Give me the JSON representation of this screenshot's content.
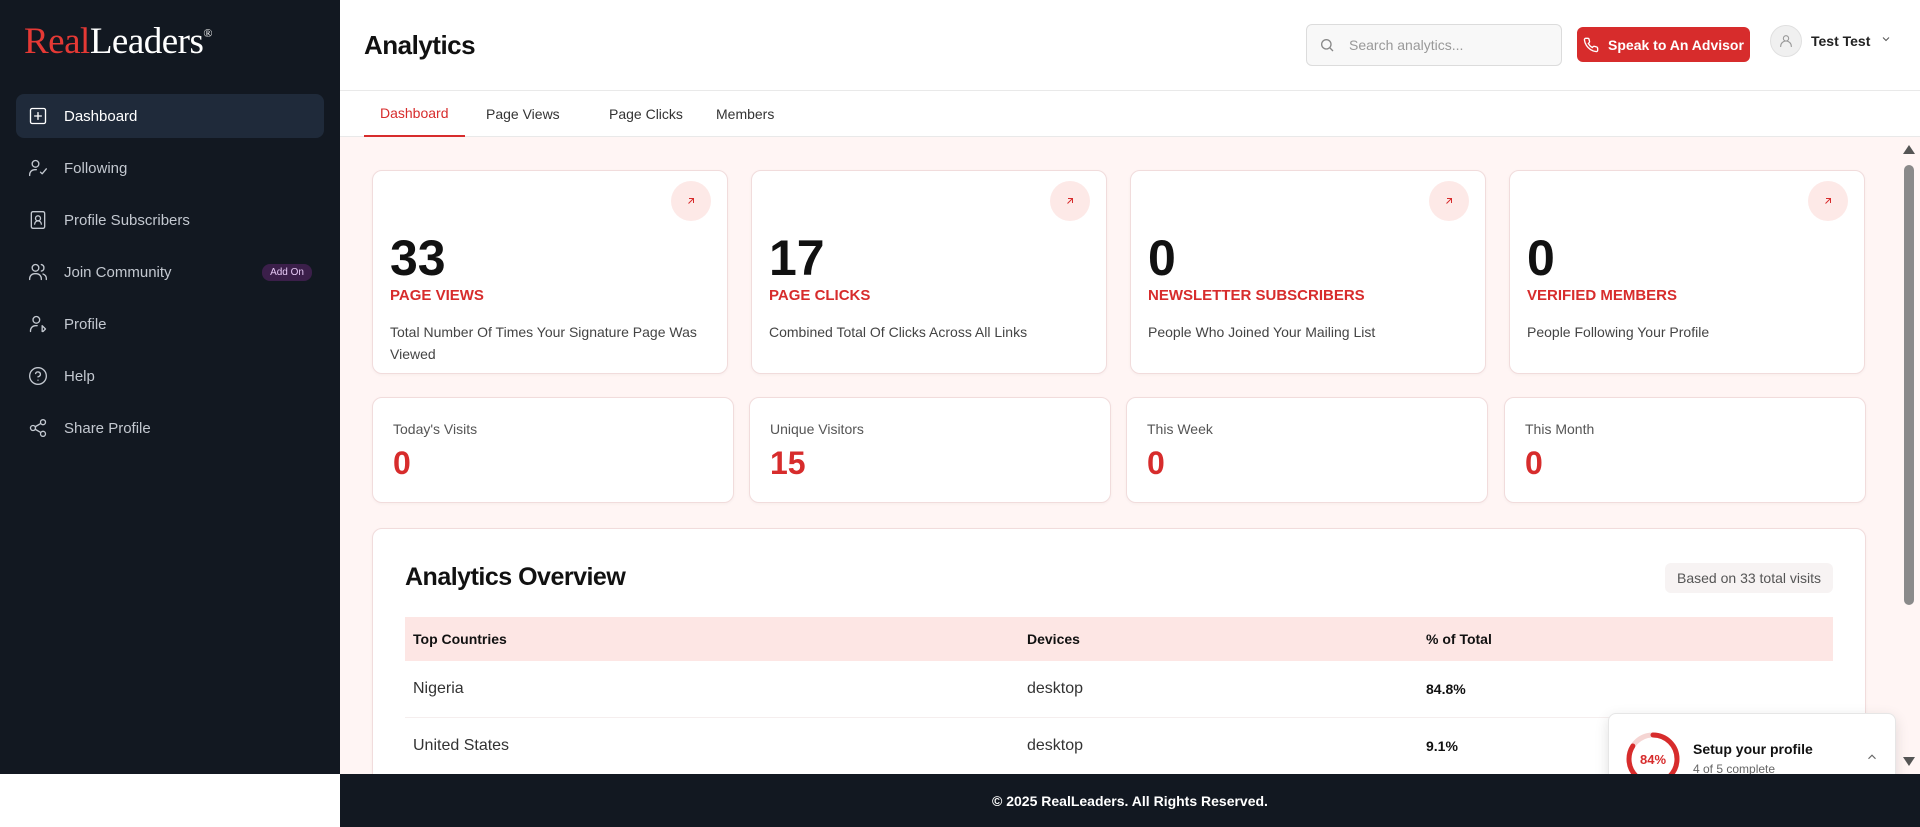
{
  "brand": {
    "logo_red": "Real",
    "logo_white": "Leaders",
    "logo_mark": "®"
  },
  "sidebar": {
    "items": [
      {
        "label": "Dashboard",
        "icon": "plus-square-icon",
        "active": true
      },
      {
        "label": "Following",
        "icon": "user-check-icon"
      },
      {
        "label": "Profile Subscribers",
        "icon": "contact-book-icon"
      },
      {
        "label": "Join Community",
        "icon": "users-icon",
        "badge": "Add On"
      },
      {
        "label": "Profile",
        "icon": "user-edit-icon"
      },
      {
        "label": "Help",
        "icon": "help-circle-icon"
      },
      {
        "label": "Share Profile",
        "icon": "share-icon"
      }
    ]
  },
  "header": {
    "title": "Analytics",
    "search_placeholder": "Search analytics...",
    "advisor_label": "Speak to An Advisor",
    "user_name": "Test Test"
  },
  "tabs": [
    {
      "label": "Dashboard",
      "active": true
    },
    {
      "label": "Page Views"
    },
    {
      "label": "Page Clicks"
    },
    {
      "label": "Members"
    }
  ],
  "stats": [
    {
      "value": "33",
      "label": "PAGE VIEWS",
      "desc": "Total Number Of Times Your Signature Page Was Viewed"
    },
    {
      "value": "17",
      "label": "PAGE CLICKS",
      "desc": "Combined Total Of Clicks Across All Links"
    },
    {
      "value": "0",
      "label": "NEWSLETTER SUBSCRIBERS",
      "desc": "People Who Joined Your Mailing List"
    },
    {
      "value": "0",
      "label": "VERIFIED MEMBERS",
      "desc": "People Following Your Profile"
    }
  ],
  "mini_stats": [
    {
      "label": "Today's Visits",
      "value": "0"
    },
    {
      "label": "Unique Visitors",
      "value": "15"
    },
    {
      "label": "This Week",
      "value": "0"
    },
    {
      "label": "This Month",
      "value": "0"
    }
  ],
  "overview": {
    "title": "Analytics Overview",
    "badge": "Based on 33 total visits",
    "columns": [
      "Top Countries",
      "Devices",
      "% of Total"
    ],
    "rows": [
      [
        "Nigeria",
        "desktop",
        "84.8%"
      ],
      [
        "United States",
        "desktop",
        "9.1%"
      ]
    ]
  },
  "setup": {
    "percent_label": "84%",
    "percent": 84,
    "title": "Setup your profile",
    "subtitle": "4 of 5 complete"
  },
  "footer": {
    "text": "© 2025 RealLeaders. All Rights Reserved."
  },
  "colors": {
    "accent": "#d72c2c",
    "sidebar_bg": "#121821",
    "main_bg": "#fff5f4"
  }
}
